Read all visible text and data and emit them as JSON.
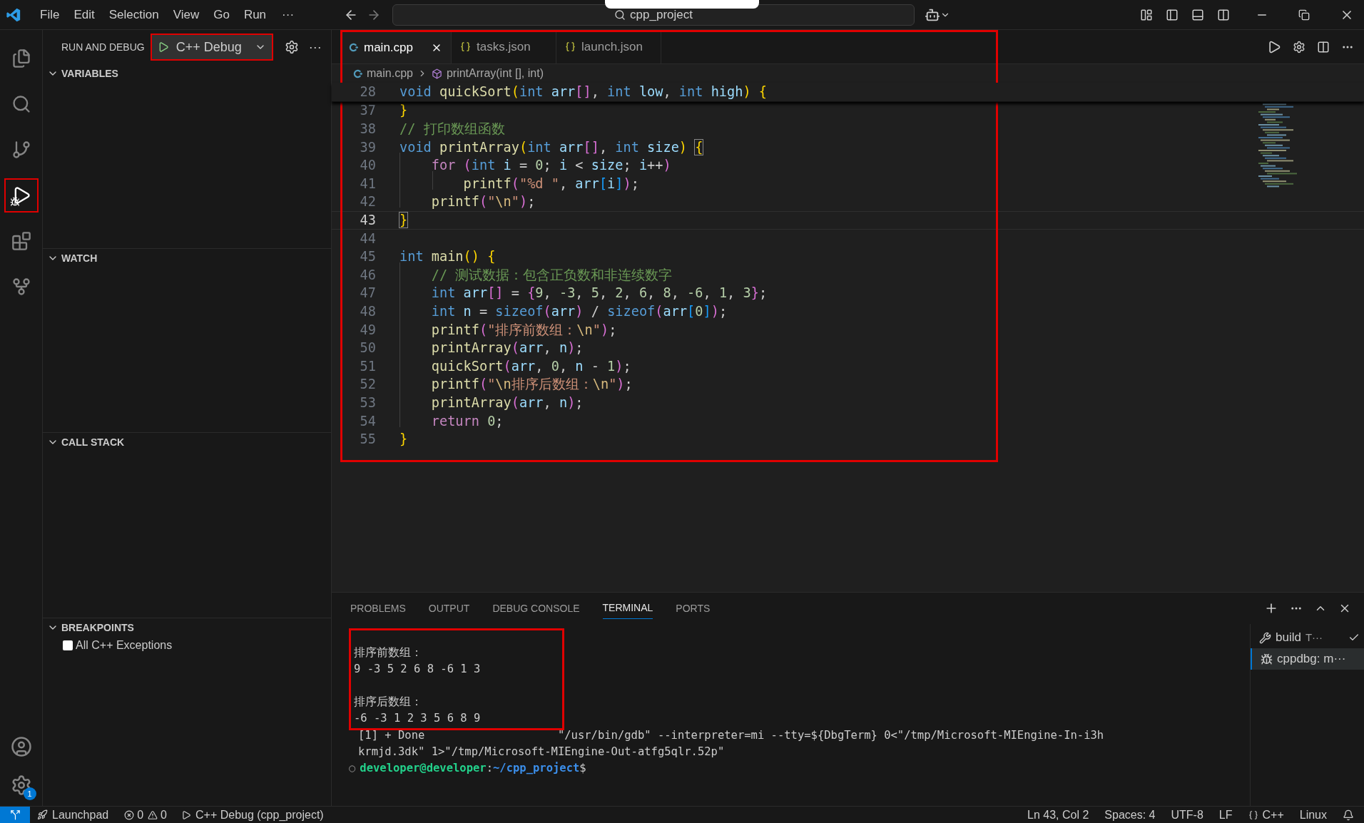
{
  "title_bar": {
    "menus": [
      "File",
      "Edit",
      "Selection",
      "View",
      "Go",
      "Run"
    ],
    "more": "···",
    "command_center": "cpp_project"
  },
  "activity_bar": {
    "items": [
      {
        "kind": "explorer",
        "selected": false
      },
      {
        "kind": "search",
        "selected": false
      },
      {
        "kind": "source-control",
        "selected": false
      },
      {
        "kind": "run-debug",
        "selected": true
      },
      {
        "kind": "extensions",
        "selected": false
      },
      {
        "kind": "git-graph",
        "selected": false
      }
    ],
    "manage_badge": "1"
  },
  "sidebar": {
    "title": "RUN AND DEBUG",
    "config": "C++ Debug",
    "more": "···",
    "sections": [
      {
        "label": "VARIABLES",
        "expanded": true
      },
      {
        "label": "WATCH",
        "expanded": true
      },
      {
        "label": "CALL STACK",
        "expanded": true
      },
      {
        "label": "BREAKPOINTS",
        "expanded": true
      }
    ],
    "breakpoints": [
      {
        "label": "All C++ Exceptions",
        "checked": false
      }
    ]
  },
  "tabs": [
    {
      "label": "main.cpp",
      "kind": "cpp",
      "selected": true
    },
    {
      "label": "tasks.json",
      "kind": "json",
      "selected": false
    },
    {
      "label": "launch.json",
      "kind": "json",
      "selected": false
    }
  ],
  "breadcrumb": [
    "main.cpp",
    "printArray(int [], int)"
  ],
  "sticky_line": {
    "number": "28",
    "tokens": [
      {
        "text": "void ",
        "kind": "kw"
      },
      {
        "text": "quickSort",
        "kind": "fn"
      },
      {
        "text": "(",
        "kind": "br1"
      },
      {
        "text": "int ",
        "kind": "kw"
      },
      {
        "text": "arr",
        "kind": "var"
      },
      {
        "text": "[]",
        "kind": "br2"
      },
      {
        "text": ", ",
        "kind": "pl"
      },
      {
        "text": "int ",
        "kind": "kw"
      },
      {
        "text": "low",
        "kind": "var"
      },
      {
        "text": ", ",
        "kind": "pl"
      },
      {
        "text": "int ",
        "kind": "kw"
      },
      {
        "text": "high",
        "kind": "var"
      },
      {
        "text": ") ",
        "kind": "br1"
      },
      {
        "text": "{",
        "kind": "br1"
      }
    ]
  },
  "code_lines": [
    {
      "number": "37",
      "current": false,
      "tokens": [
        {
          "text": "}",
          "kind": "br1"
        }
      ]
    },
    {
      "number": "38",
      "current": false,
      "tokens": [
        {
          "text": "// 打印数组函数",
          "kind": "com"
        }
      ]
    },
    {
      "number": "39",
      "current": false,
      "tokens": [
        {
          "text": "void ",
          "kind": "kw"
        },
        {
          "text": "printArray",
          "kind": "fn"
        },
        {
          "text": "(",
          "kind": "br1"
        },
        {
          "text": "int ",
          "kind": "kw"
        },
        {
          "text": "arr",
          "kind": "var"
        },
        {
          "text": "[]",
          "kind": "br2"
        },
        {
          "text": ", ",
          "kind": "pl"
        },
        {
          "text": "int ",
          "kind": "kw"
        },
        {
          "text": "size",
          "kind": "var"
        },
        {
          "text": ") ",
          "kind": "br1"
        },
        {
          "text": "{",
          "kind": "br1m"
        }
      ]
    },
    {
      "number": "40",
      "current": false,
      "tokens": [
        {
          "text": "    for ",
          "kind": "ctl"
        },
        {
          "text": "(",
          "kind": "br2"
        },
        {
          "text": "int ",
          "kind": "kw"
        },
        {
          "text": "i",
          "kind": "var"
        },
        {
          "text": " = ",
          "kind": "pl"
        },
        {
          "text": "0",
          "kind": "num"
        },
        {
          "text": "; ",
          "kind": "pl"
        },
        {
          "text": "i",
          "kind": "var"
        },
        {
          "text": " < ",
          "kind": "pl"
        },
        {
          "text": "size",
          "kind": "var"
        },
        {
          "text": "; ",
          "kind": "pl"
        },
        {
          "text": "i",
          "kind": "var"
        },
        {
          "text": "++",
          "kind": "pl"
        },
        {
          "text": ")",
          "kind": "br2"
        }
      ]
    },
    {
      "number": "41",
      "current": false,
      "tokens": [
        {
          "text": "        printf",
          "kind": "fn"
        },
        {
          "text": "(",
          "kind": "br2"
        },
        {
          "text": "\"%d \"",
          "kind": "str"
        },
        {
          "text": ", ",
          "kind": "pl"
        },
        {
          "text": "arr",
          "kind": "var"
        },
        {
          "text": "[",
          "kind": "br3"
        },
        {
          "text": "i",
          "kind": "var"
        },
        {
          "text": "]",
          "kind": "br3"
        },
        {
          "text": ")",
          "kind": "br2"
        },
        {
          "text": ";",
          "kind": "pl"
        }
      ]
    },
    {
      "number": "42",
      "current": false,
      "tokens": [
        {
          "text": "    printf",
          "kind": "fn"
        },
        {
          "text": "(",
          "kind": "br2"
        },
        {
          "text": "\"",
          "kind": "str"
        },
        {
          "text": "\\n",
          "kind": "esc"
        },
        {
          "text": "\"",
          "kind": "str"
        },
        {
          "text": ")",
          "kind": "br2"
        },
        {
          "text": ";",
          "kind": "pl"
        }
      ]
    },
    {
      "number": "43",
      "current": true,
      "tokens": [
        {
          "text": "}",
          "kind": "br1m"
        }
      ]
    },
    {
      "number": "44",
      "current": false
    },
    {
      "number": "45",
      "current": false,
      "tokens": [
        {
          "text": "int ",
          "kind": "kw"
        },
        {
          "text": "main",
          "kind": "fn"
        },
        {
          "text": "() ",
          "kind": "br1"
        },
        {
          "text": "{",
          "kind": "br1"
        }
      ]
    },
    {
      "number": "46",
      "current": false,
      "tokens": [
        {
          "text": "    // 测试数据：包含正负数和非连续数字",
          "kind": "com"
        }
      ]
    },
    {
      "number": "47",
      "current": false,
      "tokens": [
        {
          "text": "    int ",
          "kind": "kw"
        },
        {
          "text": "arr",
          "kind": "var"
        },
        {
          "text": "[]",
          "kind": "br2"
        },
        {
          "text": " = ",
          "kind": "pl"
        },
        {
          "text": "{",
          "kind": "br2"
        },
        {
          "text": "9",
          "kind": "num"
        },
        {
          "text": ", ",
          "kind": "pl"
        },
        {
          "text": "-3",
          "kind": "num"
        },
        {
          "text": ", ",
          "kind": "pl"
        },
        {
          "text": "5",
          "kind": "num"
        },
        {
          "text": ", ",
          "kind": "pl"
        },
        {
          "text": "2",
          "kind": "num"
        },
        {
          "text": ", ",
          "kind": "pl"
        },
        {
          "text": "6",
          "kind": "num"
        },
        {
          "text": ", ",
          "kind": "pl"
        },
        {
          "text": "8",
          "kind": "num"
        },
        {
          "text": ", ",
          "kind": "pl"
        },
        {
          "text": "-6",
          "kind": "num"
        },
        {
          "text": ", ",
          "kind": "pl"
        },
        {
          "text": "1",
          "kind": "num"
        },
        {
          "text": ", ",
          "kind": "pl"
        },
        {
          "text": "3",
          "kind": "num"
        },
        {
          "text": "}",
          "kind": "br2"
        },
        {
          "text": ";",
          "kind": "pl"
        }
      ]
    },
    {
      "number": "48",
      "current": false,
      "tokens": [
        {
          "text": "    int ",
          "kind": "kw"
        },
        {
          "text": "n",
          "kind": "var"
        },
        {
          "text": " = ",
          "kind": "pl"
        },
        {
          "text": "sizeof",
          "kind": "kw"
        },
        {
          "text": "(",
          "kind": "br2"
        },
        {
          "text": "arr",
          "kind": "var"
        },
        {
          "text": ")",
          "kind": "br2"
        },
        {
          "text": " / ",
          "kind": "pl"
        },
        {
          "text": "sizeof",
          "kind": "kw"
        },
        {
          "text": "(",
          "kind": "br2"
        },
        {
          "text": "arr",
          "kind": "var"
        },
        {
          "text": "[",
          "kind": "br3"
        },
        {
          "text": "0",
          "kind": "num"
        },
        {
          "text": "]",
          "kind": "br3"
        },
        {
          "text": ")",
          "kind": "br2"
        },
        {
          "text": ";",
          "kind": "pl"
        }
      ]
    },
    {
      "number": "49",
      "current": false,
      "tokens": [
        {
          "text": "    printf",
          "kind": "fn"
        },
        {
          "text": "(",
          "kind": "br2"
        },
        {
          "text": "\"排序前数组：",
          "kind": "str"
        },
        {
          "text": "\\n",
          "kind": "esc"
        },
        {
          "text": "\"",
          "kind": "str"
        },
        {
          "text": ")",
          "kind": "br2"
        },
        {
          "text": ";",
          "kind": "pl"
        }
      ]
    },
    {
      "number": "50",
      "current": false,
      "tokens": [
        {
          "text": "    printArray",
          "kind": "fn"
        },
        {
          "text": "(",
          "kind": "br2"
        },
        {
          "text": "arr",
          "kind": "var"
        },
        {
          "text": ", ",
          "kind": "pl"
        },
        {
          "text": "n",
          "kind": "var"
        },
        {
          "text": ")",
          "kind": "br2"
        },
        {
          "text": ";",
          "kind": "pl"
        }
      ]
    },
    {
      "number": "51",
      "current": false,
      "tokens": [
        {
          "text": "    quickSort",
          "kind": "fn"
        },
        {
          "text": "(",
          "kind": "br2"
        },
        {
          "text": "arr",
          "kind": "var"
        },
        {
          "text": ", ",
          "kind": "pl"
        },
        {
          "text": "0",
          "kind": "num"
        },
        {
          "text": ", ",
          "kind": "pl"
        },
        {
          "text": "n",
          "kind": "var"
        },
        {
          "text": " - ",
          "kind": "pl"
        },
        {
          "text": "1",
          "kind": "num"
        },
        {
          "text": ")",
          "kind": "br2"
        },
        {
          "text": ";",
          "kind": "pl"
        }
      ]
    },
    {
      "number": "52",
      "current": false,
      "tokens": [
        {
          "text": "    printf",
          "kind": "fn"
        },
        {
          "text": "(",
          "kind": "br2"
        },
        {
          "text": "\"",
          "kind": "str"
        },
        {
          "text": "\\n",
          "kind": "esc"
        },
        {
          "text": "排序后数组：",
          "kind": "str"
        },
        {
          "text": "\\n",
          "kind": "esc"
        },
        {
          "text": "\"",
          "kind": "str"
        },
        {
          "text": ")",
          "kind": "br2"
        },
        {
          "text": ";",
          "kind": "pl"
        }
      ]
    },
    {
      "number": "53",
      "current": false,
      "tokens": [
        {
          "text": "    printArray",
          "kind": "fn"
        },
        {
          "text": "(",
          "kind": "br2"
        },
        {
          "text": "arr",
          "kind": "var"
        },
        {
          "text": ", ",
          "kind": "pl"
        },
        {
          "text": "n",
          "kind": "var"
        },
        {
          "text": ")",
          "kind": "br2"
        },
        {
          "text": ";",
          "kind": "pl"
        }
      ]
    },
    {
      "number": "54",
      "current": false,
      "tokens": [
        {
          "text": "    return ",
          "kind": "ctl"
        },
        {
          "text": "0",
          "kind": "num"
        },
        {
          "text": ";",
          "kind": "pl"
        }
      ]
    },
    {
      "number": "55",
      "current": false,
      "tokens": [
        {
          "text": "}",
          "kind": "br1"
        }
      ]
    }
  ],
  "panel": {
    "tabs": [
      {
        "label": "PROBLEMS",
        "selected": false
      },
      {
        "label": "OUTPUT",
        "selected": false
      },
      {
        "label": "DEBUG CONSOLE",
        "selected": false
      },
      {
        "label": "TERMINAL",
        "selected": true
      },
      {
        "label": "PORTS",
        "selected": false
      }
    ],
    "output_groups": [
      [
        "排序前数组：",
        "9 -3 5 2 6 8 -6 1 3"
      ],
      [
        "排序后数组：",
        "-6 -3 1 2 3 5 6 8 9"
      ]
    ],
    "job_lines": [
      "[1] + Done                    \"/usr/bin/gdb\" --interpreter=mi --tty=${DbgTerm} 0<\"/tmp/Microsoft-MIEngine-In-i3h",
      "krmjd.3dk\" 1>\"/tmp/Microsoft-MIEngine-Out-atfg5qlr.52p\""
    ],
    "prompt": {
      "marker": "○",
      "user": "developer@developer",
      "separator": ":",
      "path": "~/cpp_project",
      "end": "$"
    },
    "sessions": [
      {
        "label": "build",
        "suffix": "T···",
        "kind": "task",
        "selected": false,
        "done": true
      },
      {
        "label": "cppdbg: m···",
        "kind": "debug",
        "selected": true,
        "done": false
      }
    ]
  },
  "status_bar": {
    "launchpad": "Launchpad",
    "errors": "0",
    "warnings": "0",
    "debug": "C++ Debug (cpp_project)",
    "position": "Ln 43, Col 2",
    "spaces": "Spaces: 4",
    "encoding": "UTF-8",
    "eol": "LF",
    "language": "C++",
    "platform": "Linux"
  }
}
